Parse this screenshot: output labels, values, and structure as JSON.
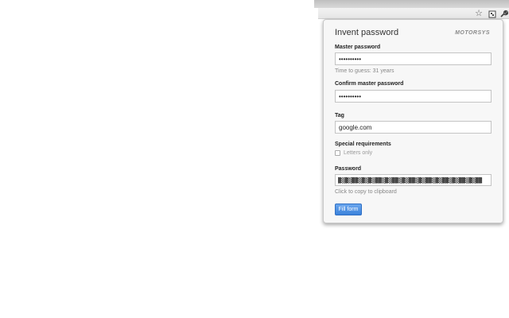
{
  "toolbar": {
    "icons": [
      "star-icon",
      "extension-icon",
      "wrench-icon"
    ]
  },
  "popup": {
    "title": "Invent password",
    "brand": "MOTORSYS",
    "master_password": {
      "label": "Master password",
      "value": "••••••••••",
      "hint": "Time to guess: 31 years"
    },
    "confirm_password": {
      "label": "Confirm master password",
      "value": "••••••••••"
    },
    "tag": {
      "label": "Tag",
      "value": "google.com"
    },
    "special_requirements": {
      "label": "Special requirements",
      "option": "Letters only",
      "checked": false
    },
    "password": {
      "label": "Password",
      "value": "▓▒▓▒▓▓▒▓▒▓▒▓▓▒▓▒▓▓▒▓▒▓▓▒▓▒▓▓▒▓▒▓▓▒▓▒▓▓▒▓▒▓▓",
      "hint": "Click to copy to clipboard"
    },
    "fill_button": "Fill form"
  },
  "colors": {
    "accent": "#3b82db",
    "popup_bg": "#f7f7f7"
  }
}
